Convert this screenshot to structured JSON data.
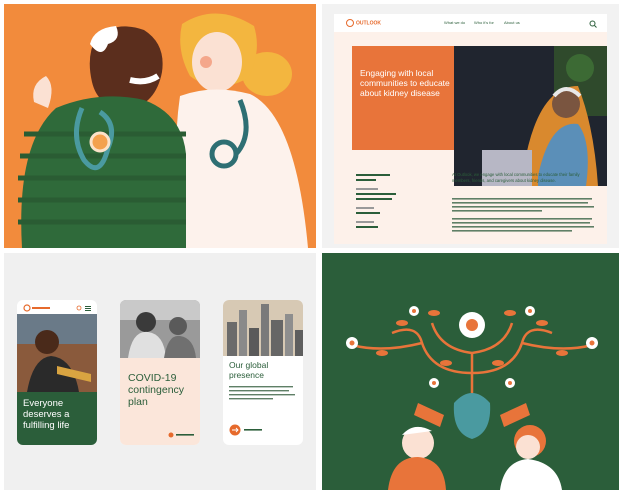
{
  "colors": {
    "orange": "#f28b3c",
    "burnt_orange": "#e8743a",
    "forest_green": "#2b5e3a",
    "peach": "#fdf1ea",
    "teal": "#4a9aa0"
  },
  "site": {
    "nav_items": [
      "What we do",
      "Who it's for",
      "About us"
    ],
    "hero_title": "Engaging with local communities to educate about kidney disease",
    "lead_text": "At Outlook, we engage with local communities to educate their family members, friends, and caregivers about kidney disease."
  },
  "cards": {
    "card1_title": "Everyone deserves a fulfilling life",
    "card2_title": "COVID-19 contingency plan",
    "card3_title": "Our global presence"
  },
  "icons": [
    "heart-stethoscope-icon",
    "search-icon",
    "arrow-icon",
    "flower-icon",
    "watering-can-icon"
  ]
}
